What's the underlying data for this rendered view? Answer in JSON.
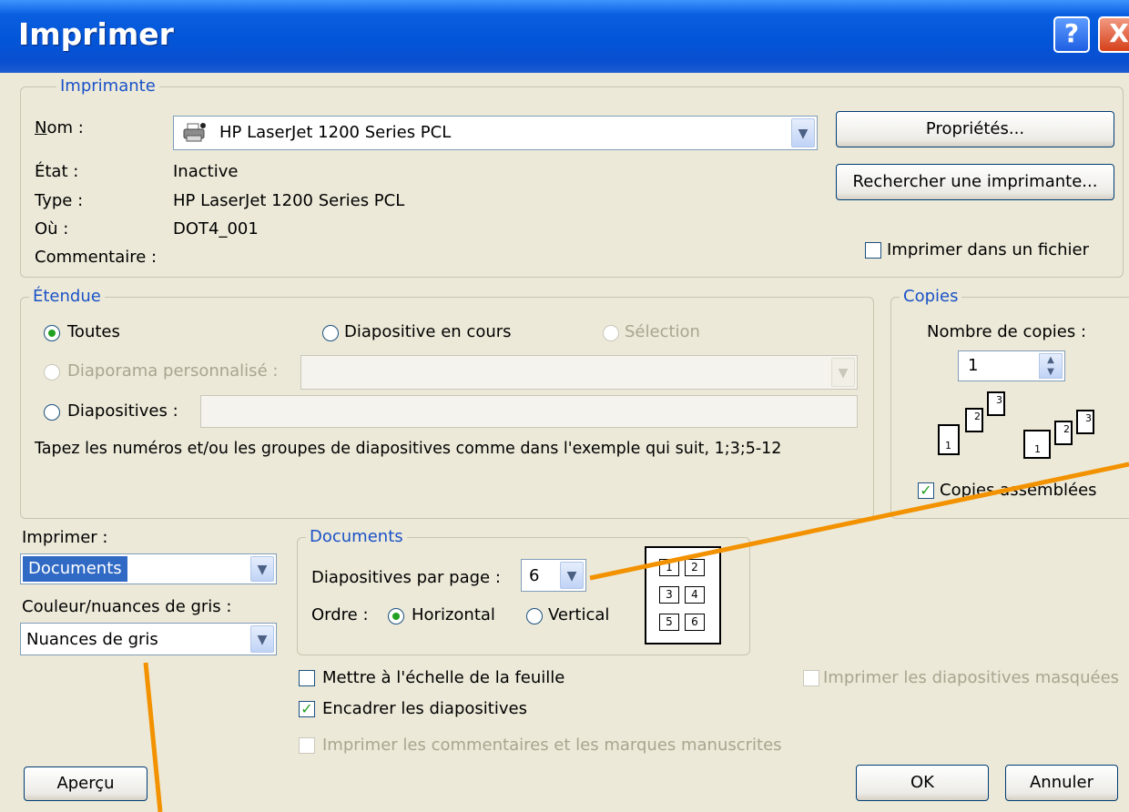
{
  "window": {
    "title": "Imprimer",
    "help": "?",
    "close": "X"
  },
  "printer": {
    "legend": "Imprimante",
    "name_label": "Nom :",
    "name_value": "HP LaserJet 1200 Series PCL",
    "state_label": "État :",
    "state_value": "Inactive",
    "type_label": "Type :",
    "type_value": "HP LaserJet 1200 Series PCL",
    "where_label": "Où :",
    "where_value": "DOT4_001",
    "comment_label": "Commentaire :",
    "properties_button": "Propriétés...",
    "find_button": "Rechercher une imprimante...",
    "print_to_file": "Imprimer dans un fichier"
  },
  "range": {
    "legend": "Étendue",
    "all": "Toutes",
    "current_slide": "Diapositive en cours",
    "selection": "Sélection",
    "custom_show": "Diaporama personnalisé :",
    "slides": "Diapositives :",
    "hint": "Tapez les numéros et/ou les groupes de diapositives comme dans l'exemple qui suit, 1;3;5-12"
  },
  "copies": {
    "legend": "Copies",
    "count_label": "Nombre de copies :",
    "count_value": "1",
    "collate": "Copies assemblées",
    "page_numbers": [
      "1",
      "2",
      "3"
    ]
  },
  "print_what": {
    "label": "Imprimer :",
    "value": "Documents",
    "color_label": "Couleur/nuances de gris :",
    "color_value": "Nuances de gris"
  },
  "documents": {
    "legend": "Documents",
    "per_page_label": "Diapositives par page :",
    "per_page_value": "6",
    "order_label": "Ordre :",
    "horizontal": "Horizontal",
    "vertical": "Vertical",
    "preview_cells": [
      "1",
      "2",
      "3",
      "4",
      "5",
      "6"
    ]
  },
  "options": {
    "scale": "Mettre à l'échelle de la feuille",
    "frame": "Encadrer les diapositives",
    "comments": "Imprimer les commentaires et les marques manuscrites",
    "hidden": "Imprimer les diapositives masquées"
  },
  "buttons": {
    "preview": "Aperçu",
    "ok": "OK",
    "cancel": "Annuler"
  },
  "colors": {
    "title_bar": "#0355d8",
    "dialog_bg": "#ece9d8",
    "legend_text": "#1a52c8",
    "annotation_line": "#f39200",
    "selection": "#316ac5"
  }
}
